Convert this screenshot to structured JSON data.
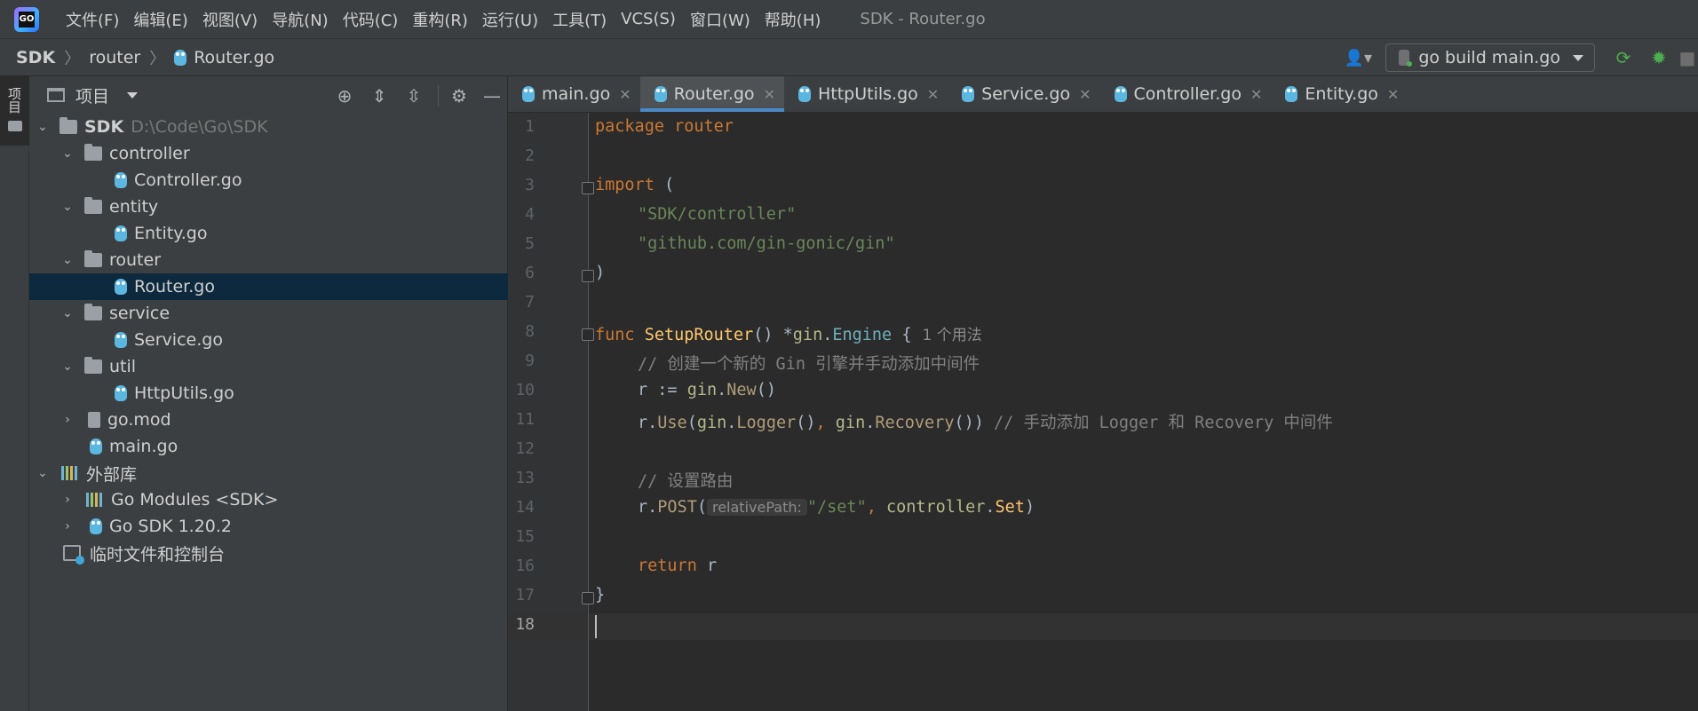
{
  "menubar": {
    "logo_text": "GO",
    "items": [
      "文件(F)",
      "编辑(E)",
      "视图(V)",
      "导航(N)",
      "代码(C)",
      "重构(R)",
      "运行(U)",
      "工具(T)",
      "VCS(S)",
      "窗口(W)",
      "帮助(H)"
    ],
    "window_title": "SDK - Router.go"
  },
  "breadcrumb": {
    "items": [
      "SDK",
      "router",
      "Router.go"
    ]
  },
  "toolbar": {
    "run_config": "go build main.go",
    "icons": [
      "user-icon",
      "rerun-icon",
      "debug-icon",
      "stop-icon"
    ]
  },
  "side_strip": {
    "label": "项目"
  },
  "project_panel": {
    "title": "项目",
    "header_icons": [
      "crosshair-icon",
      "expand-all-icon",
      "collapse-all-icon",
      "gear-icon",
      "minimize-icon"
    ],
    "tree": [
      {
        "label": "SDK",
        "hint": "D:\\Code\\Go\\SDK",
        "type": "folder",
        "level": 0,
        "expanded": true
      },
      {
        "label": "controller",
        "type": "folder",
        "level": 1,
        "expanded": true
      },
      {
        "label": "Controller.go",
        "type": "go",
        "level": 2
      },
      {
        "label": "entity",
        "type": "folder",
        "level": 1,
        "expanded": true
      },
      {
        "label": "Entity.go",
        "type": "go",
        "level": 2
      },
      {
        "label": "router",
        "type": "folder",
        "level": 1,
        "expanded": true
      },
      {
        "label": "Router.go",
        "type": "go",
        "level": 2,
        "selected": true
      },
      {
        "label": "service",
        "type": "folder",
        "level": 1,
        "expanded": true
      },
      {
        "label": "Service.go",
        "type": "go",
        "level": 2
      },
      {
        "label": "util",
        "type": "folder",
        "level": 1,
        "expanded": true
      },
      {
        "label": "HttpUtils.go",
        "type": "go",
        "level": 2
      },
      {
        "label": "go.mod",
        "type": "mod",
        "level": 1,
        "expanded": false
      },
      {
        "label": "main.go",
        "type": "go",
        "level": 1
      },
      {
        "label": "外部库",
        "type": "lib",
        "level": 0,
        "expanded": true
      },
      {
        "label": "Go Modules <SDK>",
        "type": "lib",
        "level": 1,
        "expanded": false
      },
      {
        "label": "Go SDK 1.20.2",
        "type": "go",
        "level": 1,
        "expanded": false
      },
      {
        "label": "临时文件和控制台",
        "type": "scratch",
        "level": 0
      }
    ]
  },
  "editor": {
    "tabs": [
      {
        "label": "main.go",
        "active": false
      },
      {
        "label": "Router.go",
        "active": true
      },
      {
        "label": "HttpUtils.go",
        "active": false
      },
      {
        "label": "Service.go",
        "active": false
      },
      {
        "label": "Controller.go",
        "active": false
      },
      {
        "label": "Entity.go",
        "active": false
      }
    ],
    "line_numbers": [
      "1",
      "2",
      "3",
      "4",
      "5",
      "6",
      "7",
      "8",
      "9",
      "10",
      "11",
      "12",
      "13",
      "14",
      "15",
      "16",
      "17",
      "18"
    ],
    "current_line": "18",
    "code": {
      "l1_kw": "package",
      "l1_name": " router",
      "l3_kw": "import",
      "l3_rest": " (",
      "l4": "\"SDK/controller\"",
      "l5": "\"github.com/gin-gonic/gin\"",
      "l6": ")",
      "l8_kw": "func ",
      "l8_fn": "SetupRouter",
      "l8_a": "() *",
      "l8_pkg": "gin",
      "l8_dot": ".",
      "l8_typ": "Engine",
      "l8_b": " {",
      "l8_usage": "1 个用法",
      "l9": "// 创建一个新的 Gin 引擎并手动添加中间件",
      "l10_a": "r := ",
      "l10_pkg": "gin",
      "l10_dot": ".",
      "l10_call": "New",
      "l10_b": "()",
      "l11_a": "r.",
      "l11_m": "Use",
      "l11_b": "(",
      "l11_pkg1": "gin",
      "l11_dot1": ".",
      "l11_c1": "Logger",
      "l11_c": "()",
      "l11_comma": ", ",
      "l11_pkg2": "gin",
      "l11_dot2": ".",
      "l11_c2": "Recovery",
      "l11_d": "()) ",
      "l11_cmt": "// 手动添加 Logger 和 Recovery 中间件",
      "l13": "// 设置路由",
      "l14_a": "r.",
      "l14_m": "POST",
      "l14_b": "(",
      "l14_hint": "relativePath:",
      "l14_str": "\"/set\"",
      "l14_comma": ", ",
      "l14_pkg": "controller",
      "l14_dot": ".",
      "l14_fn": "Set",
      "l14_c": ")",
      "l16_kw": "return",
      "l16_rest": " r",
      "l17": "}"
    }
  },
  "colors": {
    "keyword": "#cc7832",
    "string": "#6a8759",
    "function": "#ffc66d",
    "comment": "#808080",
    "accent": "#4a88c7",
    "selection": "#0d293e",
    "run_green": "#4caf50"
  }
}
